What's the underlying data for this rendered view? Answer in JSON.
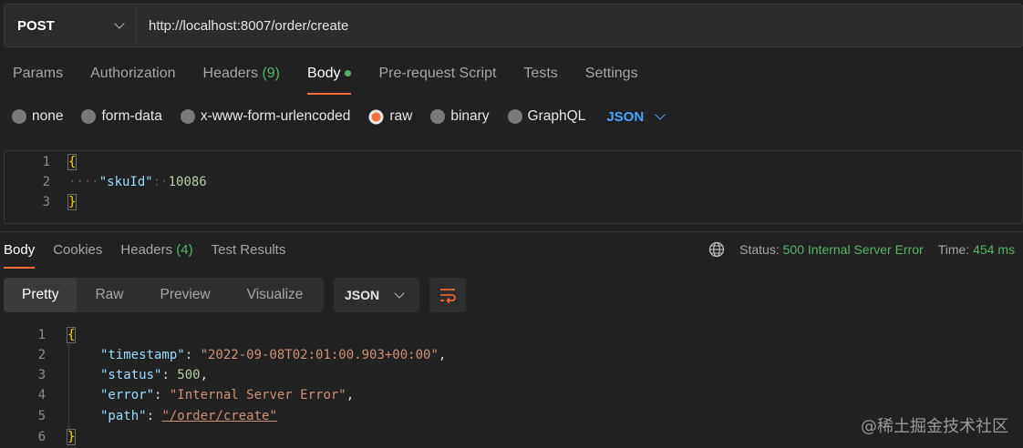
{
  "request": {
    "method": "POST",
    "url": "http://localhost:8007/order/create"
  },
  "request_tabs": [
    {
      "label": "Params",
      "count": ""
    },
    {
      "label": "Authorization",
      "count": ""
    },
    {
      "label": "Headers",
      "count": "(9)"
    },
    {
      "label": "Body",
      "count": ""
    },
    {
      "label": "Pre-request Script",
      "count": ""
    },
    {
      "label": "Tests",
      "count": ""
    },
    {
      "label": "Settings",
      "count": ""
    }
  ],
  "body_types": [
    "none",
    "form-data",
    "x-www-form-urlencoded",
    "raw",
    "binary",
    "GraphQL"
  ],
  "body_type_selected": "raw",
  "body_format": "JSON",
  "request_body": {
    "line_numbers": [
      "1",
      "2",
      "3"
    ],
    "open_brace": "{",
    "whitespace": "····",
    "key": "\"skuId\"",
    "colon": ":·",
    "value": "10086",
    "close_brace": "}"
  },
  "response_tabs": [
    {
      "label": "Body",
      "count": ""
    },
    {
      "label": "Cookies",
      "count": ""
    },
    {
      "label": "Headers",
      "count": "(4)"
    },
    {
      "label": "Test Results",
      "count": ""
    }
  ],
  "response_meta": {
    "status_label": "Status:",
    "status_value": "500 Internal Server Error",
    "time_label": "Time:",
    "time_value": "454 ms"
  },
  "view_modes": [
    "Pretty",
    "Raw",
    "Preview",
    "Visualize"
  ],
  "response_format": "JSON",
  "response_body": {
    "line_numbers": [
      "1",
      "2",
      "3",
      "4",
      "5",
      "6"
    ],
    "open_brace": "{",
    "close_brace": "}",
    "fields": [
      {
        "key": "\"timestamp\"",
        "value": "\"2022-09-08T02:01:00.903+00:00\"",
        "trail": ","
      },
      {
        "key": "\"status\"",
        "value": "500",
        "trail": ","
      },
      {
        "key": "\"error\"",
        "value": "\"Internal Server Error\"",
        "trail": ","
      },
      {
        "key": "\"path\"",
        "value": "\"/order/create\"",
        "trail": ""
      }
    ]
  },
  "watermark": "@稀土掘金技术社区",
  "colors": {
    "background": "#212121",
    "accent": "#ff6c37",
    "success": "#58b368",
    "link": "#4da3ff"
  }
}
